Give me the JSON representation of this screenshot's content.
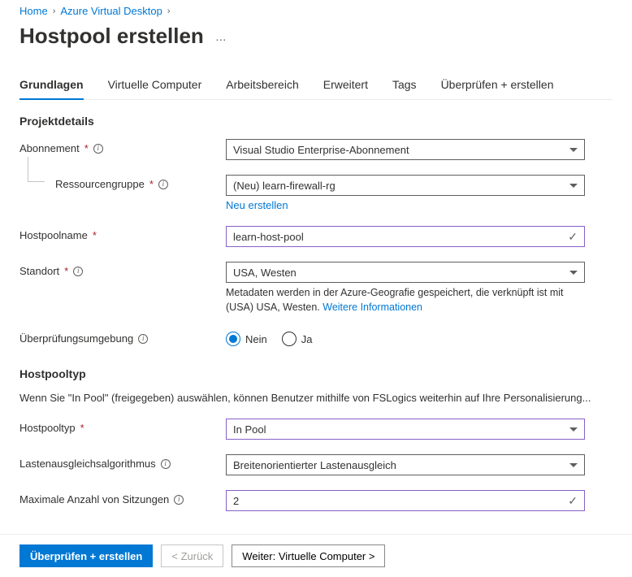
{
  "breadcrumb": {
    "home": "Home",
    "parent": "Azure Virtual Desktop"
  },
  "title": "Hostpool erstellen",
  "tabs": [
    {
      "label": "Grundlagen"
    },
    {
      "label": "Virtuelle Computer"
    },
    {
      "label": "Arbeitsbereich"
    },
    {
      "label": "Erweitert"
    },
    {
      "label": "Tags"
    },
    {
      "label": "Überprüfen + erstellen"
    }
  ],
  "sections": {
    "project": "Projektdetails",
    "hostpooltype": "Hostpooltyp"
  },
  "labels": {
    "subscription": "Abonnement",
    "resourceGroup": "Ressourcengruppe",
    "hostpoolName": "Hostpoolname",
    "location": "Standort",
    "validationEnv": "Überprüfungsumgebung",
    "hostpoolType": "Hostpooltyp",
    "loadBalancing": "Lastenausgleichsalgorithmus",
    "maxSessions": "Maximale Anzahl von Sitzungen"
  },
  "values": {
    "subscription": "Visual Studio Enterprise-Abonnement",
    "resourceGroup": "(Neu) learn-firewall-rg",
    "hostpoolName": "learn-host-pool",
    "location": "USA, Westen",
    "hostpoolType": "In Pool",
    "loadBalancing": "Breitenorientierter Lastenausgleich",
    "maxSessions": "2"
  },
  "links": {
    "createNew": "Neu erstellen",
    "moreInfo": "Weitere Informationen"
  },
  "helper": {
    "locationPrefix": "Metadaten werden in der Azure-Geografie gespeichert, die verknüpft ist mit (USA) USA, Westen. "
  },
  "radios": {
    "no": "Nein",
    "yes": "Ja"
  },
  "typeDesc": "Wenn Sie \"In Pool\" (freigegeben) auswählen, können Benutzer mithilfe von FSLogics weiterhin auf Ihre Personalisierung...",
  "footer": {
    "review": "Überprüfen + erstellen",
    "back": "< Zurück",
    "next": "Weiter: Virtuelle Computer >"
  }
}
